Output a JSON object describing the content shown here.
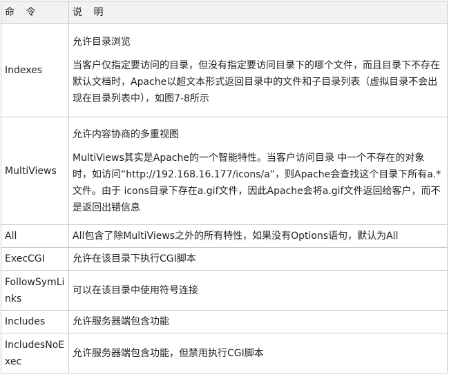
{
  "table": {
    "header": {
      "command": "命 令",
      "description": "说 明"
    },
    "rows": [
      {
        "command": "Indexes",
        "paragraphs": [
          "允许目录浏览",
          "当客户仅指定要访问的目录，但没有指定要访问目录下的哪个文件，而且目录下不存在默认文档时，Apache以超文本形式返回目录中的文件和子目录列表（虚拟目录不会出现在目录列表中），如图7-8所示"
        ]
      },
      {
        "command": "MultiViews",
        "paragraphs": [
          "允许内容协商的多重视图",
          "MultiViews其实是Apache的一个智能特性。当客户访问目录 中一个不存在的对象时，如访问“http://192.168.16.177/icons/a”，则Apache会查找这个目录下所有a.*文件。由于 icons目录下存在a.gif文件，因此Apache会将a.gif文件返回给客户，而不是返回出错信息"
        ]
      },
      {
        "command": "All",
        "paragraphs": [
          "All包含了除MultiViews之外的所有特性，如果没有Options语句，默认为All"
        ]
      },
      {
        "command": "ExecCGI",
        "paragraphs": [
          "允许在该目录下执行CGI脚本"
        ]
      },
      {
        "command": "FollowSymLinks",
        "paragraphs": [
          "可以在该目录中使用符号连接"
        ]
      },
      {
        "command": "Includes",
        "paragraphs": [
          "允许服务器端包含功能"
        ]
      },
      {
        "command": "IncludesNoExec",
        "paragraphs": [
          "允许服务器端包含功能，但禁用执行CGI脚本"
        ]
      }
    ]
  }
}
